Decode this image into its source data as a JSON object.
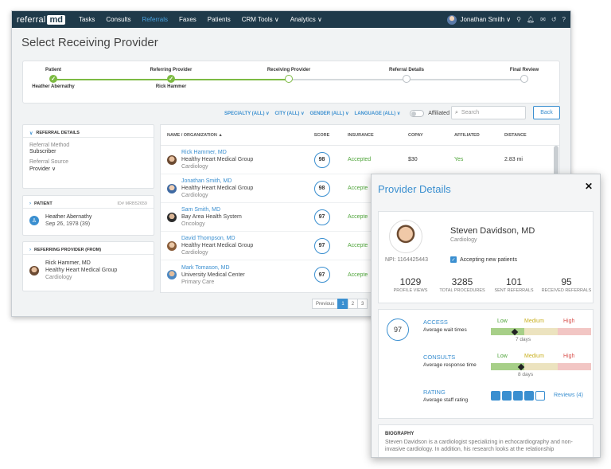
{
  "nav": {
    "logo_text": "referral",
    "logo_box": "md",
    "items": [
      "Tasks",
      "Consults",
      "Referrals",
      "Faxes",
      "Patients",
      "CRM Tools ∨",
      "Analytics ∨"
    ],
    "active_index": 2,
    "user": "Jonathan Smith ∨"
  },
  "page": {
    "title": "Select Receiving Provider"
  },
  "stepper": {
    "steps": [
      {
        "label": "Patient",
        "sub": "Heather Abernathy",
        "state": "done"
      },
      {
        "label": "Referring Provider",
        "sub": "Rick Hammer",
        "state": "done"
      },
      {
        "label": "Receiving Provider",
        "sub": "",
        "state": "current"
      },
      {
        "label": "Referral Details",
        "sub": "",
        "state": "todo"
      },
      {
        "label": "Final Review",
        "sub": "",
        "state": "todo"
      }
    ]
  },
  "filters": {
    "items": [
      "SPECIALTY (ALL) ∨",
      "CITY (ALL) ∨",
      "GENDER (ALL) ∨",
      "LANGUAGE (ALL) ∨"
    ],
    "affiliated_label": "Affiliated",
    "search_placeholder": "Search",
    "back_label": "Back"
  },
  "referral_details": {
    "header": "REFERRAL DETAILS",
    "method_label": "Referral Method",
    "method_value": "Subscriber",
    "source_label": "Referral Source",
    "source_value": "Provider ∨"
  },
  "patient": {
    "header": "PATIENT",
    "id": "ID# MRB52659",
    "name": "Heather Abernathy",
    "dob": "Sep 26, 1978 (39)"
  },
  "referring_provider": {
    "header": "REFERRING PROVIDER (FROM)",
    "name": "Rick Hammer, MD",
    "org": "Healthy Heart Medical Group",
    "specialty": "Cardiology"
  },
  "table": {
    "columns": [
      "NAME / ORGANIZATION ▲",
      "SCORE",
      "INSURANCE",
      "COPAY",
      "AFFILIATED",
      "DISTANCE"
    ],
    "rows": [
      {
        "name": "Rick Hammer, MD",
        "org": "Healthy Heart Medical Group",
        "specialty": "Cardiology",
        "score": "98",
        "insurance": "Accepted",
        "copay": "$30",
        "affiliated": "Yes",
        "distance": "2.83 mi"
      },
      {
        "name": "Jonathan Smith, MD",
        "org": "Healthy Heart Medical Group",
        "specialty": "Cardiology",
        "score": "98",
        "insurance": "Accepte",
        "copay": "",
        "affiliated": "",
        "distance": ""
      },
      {
        "name": "Sam Smith, MD",
        "org": "Bay Area Health System",
        "specialty": "Oncology",
        "score": "97",
        "insurance": "Accepte",
        "copay": "",
        "affiliated": "",
        "distance": ""
      },
      {
        "name": "David Thompson, MD",
        "org": "Healthy Heart Medical Group",
        "specialty": "Cardiology",
        "score": "97",
        "insurance": "Accepte",
        "copay": "",
        "affiliated": "",
        "distance": ""
      },
      {
        "name": "Mark Tomason, MD",
        "org": "University Medical Center",
        "specialty": "Primary Care",
        "score": "97",
        "insurance": "Accepte",
        "copay": "",
        "affiliated": "",
        "distance": ""
      }
    ]
  },
  "pager": {
    "prev": "Previous",
    "pages": [
      "1",
      "2",
      "3"
    ],
    "active": 0
  },
  "provider_details": {
    "title": "Provider Details",
    "name": "Steven Davidson, MD",
    "specialty": "Cardiology",
    "npi": "NPI: 1164425443",
    "accepting": "Accepting new patients",
    "stats": [
      {
        "num": "1029",
        "label": "PROFILE VIEWS"
      },
      {
        "num": "3285",
        "label": "TOTAL PROCEDURES"
      },
      {
        "num": "101",
        "label": "SENT REFERRALS"
      },
      {
        "num": "95",
        "label": "RECEIVED REFERRALS"
      }
    ],
    "score": "97",
    "level_labels": {
      "low": "Low",
      "medium": "Medium",
      "high": "High"
    },
    "access": {
      "title": "ACCESS",
      "sub": "Average wait times",
      "days": "7 days",
      "level": 0.24
    },
    "consults": {
      "title": "CONSULTS",
      "sub": "Average response time",
      "days": "8 days",
      "level": 0.3
    },
    "rating": {
      "title": "RATING",
      "sub": "Average staff rating",
      "reviews": "Reviews (4)",
      "stars": 4,
      "max": 5
    },
    "bio_header": "BIOGRAPHY",
    "bio_text": "Steven Davidson is a cardiologist specializing in echocardiography and non-invasive cardiology. In addition, his research looks at the relationship"
  },
  "colors": {
    "accent": "#3a8fd0",
    "nav": "#1f3a4a",
    "success": "#7dbb43"
  }
}
